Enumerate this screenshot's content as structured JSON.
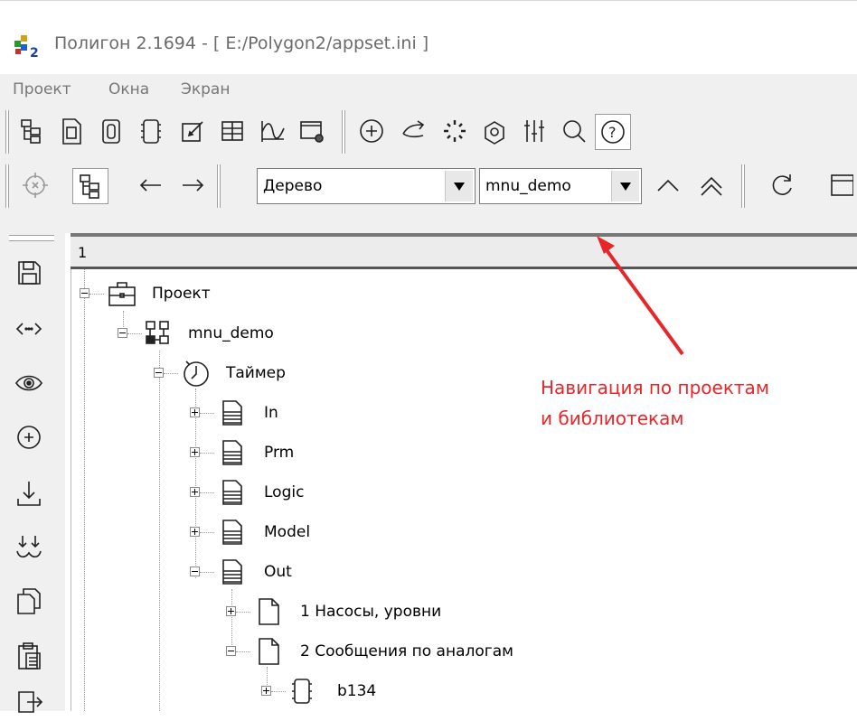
{
  "window": {
    "title": "Полигон 2.1694 - [ E:/Polygon2/appset.ini ]"
  },
  "menu": [
    "Проект",
    "Окна",
    "Экран"
  ],
  "nav_toolbar": {
    "view_combo": "Дерево",
    "project_combo": "mnu_demo"
  },
  "tree": {
    "tab_label": "1",
    "nodes": [
      {
        "label": "Проект",
        "expanded": true,
        "icon": "briefcase-icon"
      },
      {
        "label": "mnu_demo",
        "expanded": true,
        "icon": "module-icon"
      },
      {
        "label": "Таймер",
        "expanded": true,
        "icon": "clock-icon"
      },
      {
        "label": "In",
        "expanded": false,
        "icon": "stack-icon"
      },
      {
        "label": "Prm",
        "expanded": false,
        "icon": "stack-icon"
      },
      {
        "label": "Logic",
        "expanded": false,
        "icon": "stack-icon"
      },
      {
        "label": "Model",
        "expanded": false,
        "icon": "stack-icon"
      },
      {
        "label": "Out",
        "expanded": true,
        "icon": "stack-icon"
      },
      {
        "label": "1 Насосы, уровни",
        "expanded": false,
        "icon": "page-icon"
      },
      {
        "label": "2 Сообщения по аналогам",
        "expanded": true,
        "icon": "page-icon"
      },
      {
        "label": "b134",
        "expanded": false,
        "icon": "chip-icon"
      }
    ]
  },
  "annotation": {
    "line1": "Навигация по проектам",
    "line2": "и библиотекам",
    "color": "#e8262a"
  }
}
